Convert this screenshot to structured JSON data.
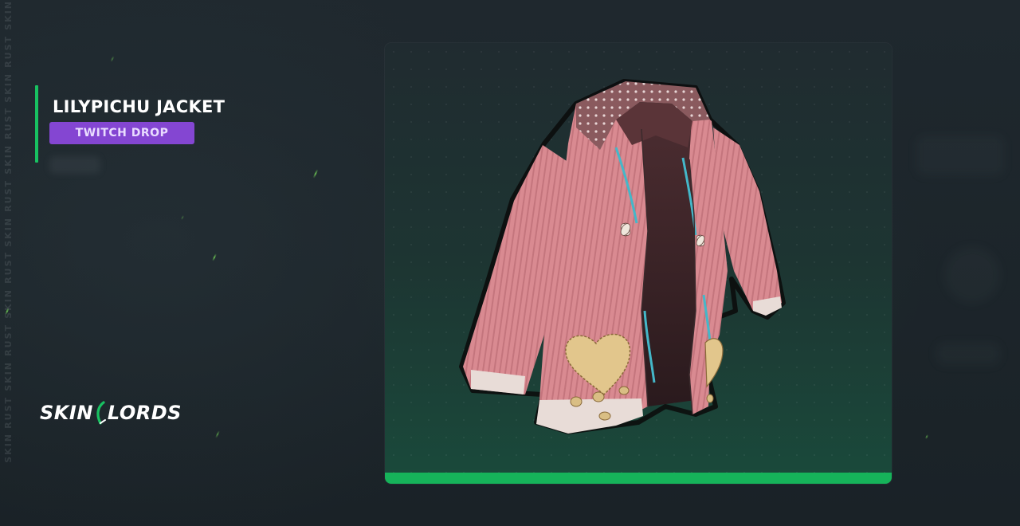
{
  "item": {
    "title": "LILYPICHU JACKET",
    "badge": "TWITCH DROP"
  },
  "brand": {
    "left_word": "SKIN",
    "right_word": "LORDS",
    "accent_color": "#18c161"
  },
  "side_watermark": {
    "words": [
      "SKIN",
      "RUST",
      "SKIN",
      "RUST",
      "SKIN",
      "RUST",
      "SKIN",
      "RUST",
      "SKIN",
      "RUST",
      "SKIN",
      "RUST",
      "SKIN"
    ]
  },
  "colors": {
    "background": "#1c242a",
    "accent_green": "#18c161",
    "badge_purple": "#8446d2",
    "jacket_pink": "#d98c92"
  },
  "icons": {
    "jacket": "pink-jacket-image",
    "logo": "skinlords-logo"
  }
}
